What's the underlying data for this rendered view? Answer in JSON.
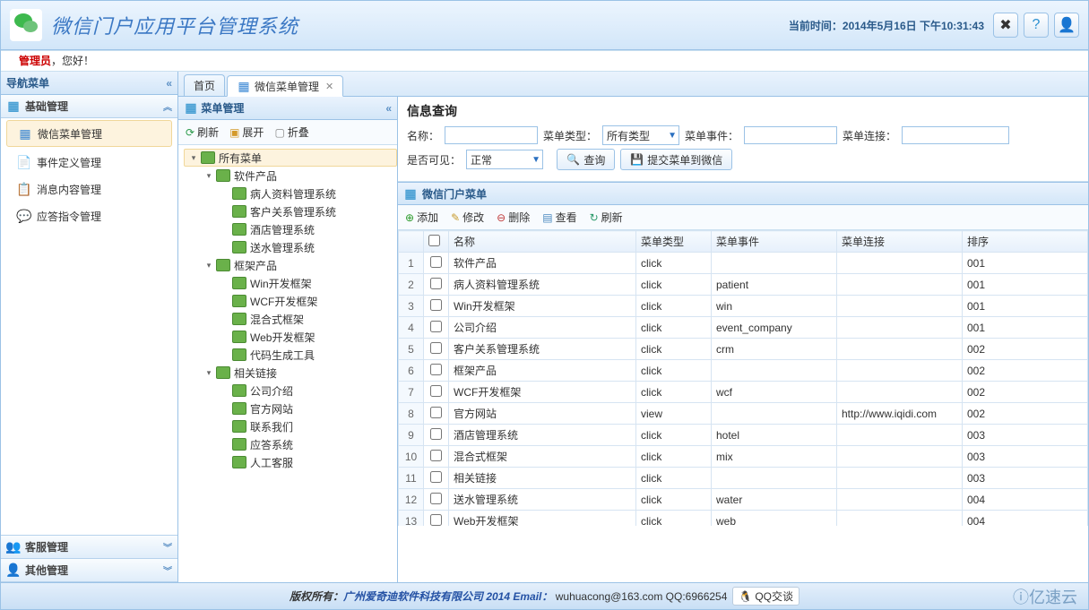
{
  "app": {
    "title": "微信门户应用平台管理系统"
  },
  "clock": {
    "label": "当前时间：",
    "value": "2014年5月16日 下午10:31:43"
  },
  "user_greeting": {
    "role": "管理员",
    "suffix": "，您好！"
  },
  "nav": {
    "title": "导航菜单",
    "groups": [
      {
        "label": "基础管理",
        "items": [
          {
            "label": "微信菜单管理",
            "active": true,
            "icon": "menu"
          },
          {
            "label": "事件定义管理",
            "icon": "event"
          },
          {
            "label": "消息内容管理",
            "icon": "msg"
          },
          {
            "label": "应答指令管理",
            "icon": "cmd"
          }
        ]
      },
      {
        "label": "客服管理"
      },
      {
        "label": "其他管理"
      }
    ]
  },
  "tabs": [
    {
      "label": "首页",
      "closable": false,
      "active": false
    },
    {
      "label": "微信菜单管理",
      "closable": true,
      "active": true
    }
  ],
  "tree": {
    "title": "菜单管理",
    "toolbar": {
      "refresh": "刷新",
      "expand": "展开",
      "collapse": "折叠"
    },
    "nodes": [
      {
        "label": "所有菜单",
        "level": 0,
        "exp": true
      },
      {
        "label": "软件产品",
        "level": 1,
        "exp": true
      },
      {
        "label": "病人资料管理系统",
        "level": 2
      },
      {
        "label": "客户关系管理系统",
        "level": 2
      },
      {
        "label": "酒店管理系统",
        "level": 2
      },
      {
        "label": "送水管理系统",
        "level": 2
      },
      {
        "label": "框架产品",
        "level": 1,
        "exp": true
      },
      {
        "label": "Win开发框架",
        "level": 2
      },
      {
        "label": "WCF开发框架",
        "level": 2
      },
      {
        "label": "混合式框架",
        "level": 2
      },
      {
        "label": "Web开发框架",
        "level": 2
      },
      {
        "label": "代码生成工具",
        "level": 2
      },
      {
        "label": "相关链接",
        "level": 1,
        "exp": true
      },
      {
        "label": "公司介绍",
        "level": 2
      },
      {
        "label": "官方网站",
        "level": 2
      },
      {
        "label": "联系我们",
        "level": 2
      },
      {
        "label": "应答系统",
        "level": 2
      },
      {
        "label": "人工客服",
        "level": 2
      }
    ]
  },
  "query": {
    "title": "信息查询",
    "name_label": "名称：",
    "type_label": "菜单类型：",
    "type_value": "所有类型",
    "event_label": "菜单事件：",
    "link_label": "菜单连接：",
    "visible_label": "是否可见：",
    "visible_value": "正常",
    "search_btn": "查询",
    "submit_btn": "提交菜单到微信"
  },
  "grid": {
    "title": "微信门户菜单",
    "toolbar": {
      "add": "添加",
      "edit": "修改",
      "del": "删除",
      "view": "查看",
      "refresh": "刷新"
    },
    "columns": [
      "",
      "",
      "名称",
      "菜单类型",
      "菜单事件",
      "菜单连接",
      "排序"
    ],
    "rows": [
      {
        "n": 1,
        "name": "软件产品",
        "type": "click",
        "event": "",
        "link": "",
        "order": "001"
      },
      {
        "n": 2,
        "name": "病人资料管理系统",
        "type": "click",
        "event": "patient",
        "link": "",
        "order": "001"
      },
      {
        "n": 3,
        "name": "Win开发框架",
        "type": "click",
        "event": "win",
        "link": "",
        "order": "001"
      },
      {
        "n": 4,
        "name": "公司介绍",
        "type": "click",
        "event": "event_company",
        "link": "",
        "order": "001"
      },
      {
        "n": 5,
        "name": "客户关系管理系统",
        "type": "click",
        "event": "crm",
        "link": "",
        "order": "002"
      },
      {
        "n": 6,
        "name": "框架产品",
        "type": "click",
        "event": "",
        "link": "",
        "order": "002"
      },
      {
        "n": 7,
        "name": "WCF开发框架",
        "type": "click",
        "event": "wcf",
        "link": "",
        "order": "002"
      },
      {
        "n": 8,
        "name": "官方网站",
        "type": "view",
        "event": "",
        "link": "http://www.iqidi.com",
        "order": "002"
      },
      {
        "n": 9,
        "name": "酒店管理系统",
        "type": "click",
        "event": "hotel",
        "link": "",
        "order": "003"
      },
      {
        "n": 10,
        "name": "混合式框架",
        "type": "click",
        "event": "mix",
        "link": "",
        "order": "003"
      },
      {
        "n": 11,
        "name": "相关链接",
        "type": "click",
        "event": "",
        "link": "",
        "order": "003"
      },
      {
        "n": 12,
        "name": "送水管理系统",
        "type": "click",
        "event": "water",
        "link": "",
        "order": "004"
      },
      {
        "n": 13,
        "name": "Web开发框架",
        "type": "click",
        "event": "web",
        "link": "",
        "order": "004"
      }
    ]
  },
  "footer": {
    "copyright": "版权所有：",
    "company": "广州爱奇迪软件科技有限公司 2014 Email：",
    "email": "wuhuacong@163.com",
    "qq_label": "QQ:6966254",
    "qq_chat": "QQ交谈",
    "brand": "亿速云"
  }
}
